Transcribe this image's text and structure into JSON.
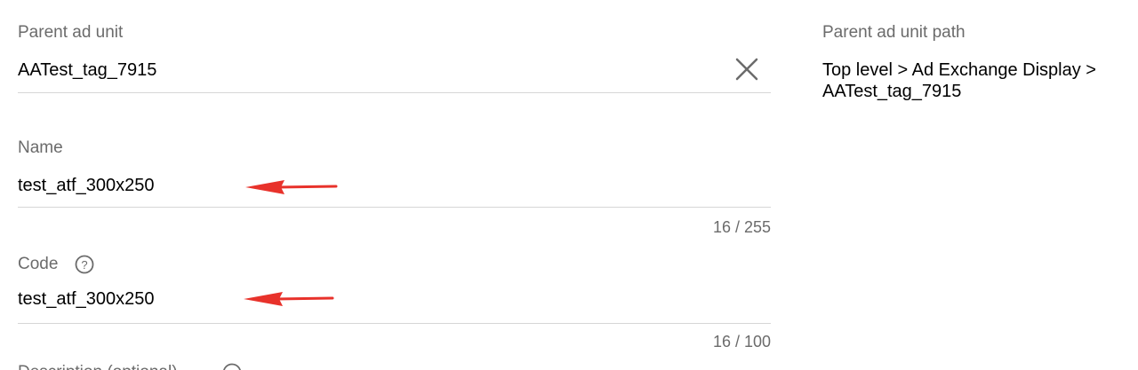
{
  "parent_ad_unit": {
    "label": "Parent ad unit",
    "value": "AATest_tag_7915",
    "clear_icon": "close-icon"
  },
  "parent_ad_unit_path": {
    "label": "Parent ad unit path",
    "value": "Top level > Ad Exchange Display > AATest_tag_7915"
  },
  "name_field": {
    "label": "Name",
    "value": "test_atf_300x250",
    "counter": "16 / 255"
  },
  "code_field": {
    "label": "Code",
    "help_icon": "help-circle-icon",
    "value": "test_atf_300x250",
    "counter": "16 / 100"
  },
  "description_field": {
    "label": "Description (optional)",
    "help_icon": "help-circle-icon"
  },
  "annotations": {
    "arrow_color": "#e8322b",
    "arrow_icon": "red-arrow-left-icon"
  },
  "colors": {
    "label": "#6b6b6b",
    "underline": "#d6d6d6",
    "value": "#000000"
  }
}
